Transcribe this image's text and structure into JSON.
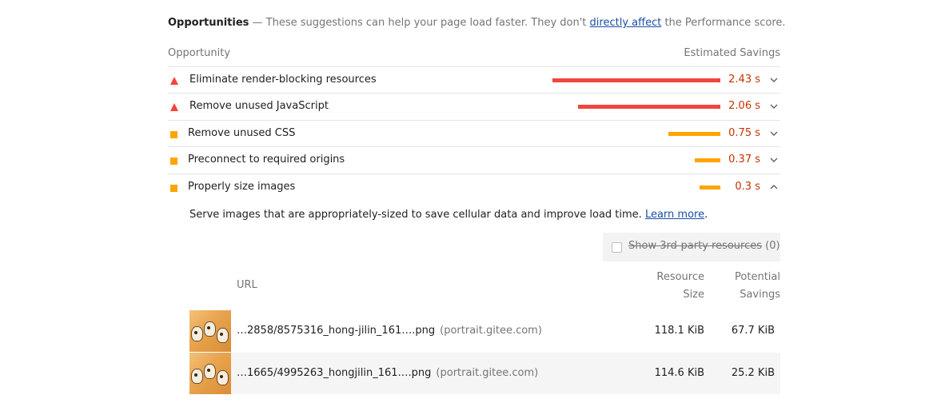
{
  "header": {
    "title": "Opportunities",
    "text_before_link": " — These suggestions can help your page load faster. They don't ",
    "link": "directly affect",
    "text_after_link": " the Performance score."
  },
  "columns": {
    "opportunity": "Opportunity",
    "savings": "Estimated Savings"
  },
  "audits": [
    {
      "label": "Eliminate render-blocking resources",
      "value": "2.43 s",
      "severity": "fail",
      "bar_fraction": 1.0,
      "expanded": false
    },
    {
      "label": "Remove unused JavaScript",
      "value": "2.06 s",
      "severity": "fail",
      "bar_fraction": 0.848,
      "expanded": false
    },
    {
      "label": "Remove unused CSS",
      "value": "0.75 s",
      "severity": "average",
      "bar_fraction": 0.309,
      "expanded": false
    },
    {
      "label": "Preconnect to required origins",
      "value": "0.37 s",
      "severity": "average",
      "bar_fraction": 0.152,
      "expanded": false
    },
    {
      "label": "Properly size images",
      "value": "0.3 s",
      "severity": "average",
      "bar_fraction": 0.123,
      "expanded": true
    }
  ],
  "details": {
    "description": "Serve images that are appropriately-sized to save cellular data and improve load time. ",
    "learn_more": "Learn more",
    "period": ".",
    "third_party_label": "Show 3rd-party resources",
    "third_party_count": "(0)",
    "table_headers": {
      "url": "URL",
      "resource_size_line1": "Resource",
      "resource_size_line2": "Size",
      "potential_savings_line1": "Potential",
      "potential_savings_line2": "Savings"
    },
    "rows": [
      {
        "url": "…2858/8575316_hong-jilin_161….png",
        "host": "(portrait.gitee.com)",
        "size": "118.1 KiB",
        "savings": "67.7 KiB"
      },
      {
        "url": "…1665/4995263_hongjilin_161….png",
        "host": "(portrait.gitee.com)",
        "size": "114.6 KiB",
        "savings": "25.2 KiB"
      }
    ]
  },
  "colors": {
    "fail": "#f1453d",
    "fail_text": "#c33300",
    "average": "#ffa400",
    "link": "#1a4ea8"
  },
  "icons": {
    "fail": "red-triangle-icon",
    "average": "orange-square-icon",
    "collapsed": "chevron-down-icon",
    "expanded": "chevron-up-icon"
  }
}
